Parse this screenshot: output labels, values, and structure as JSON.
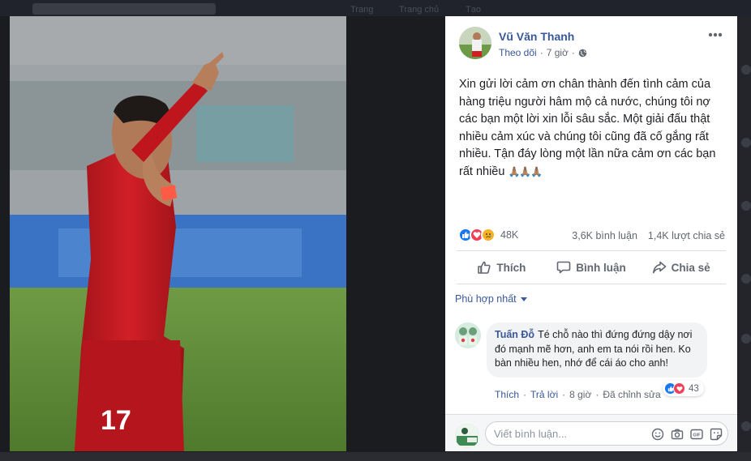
{
  "background": {
    "nav_items": [
      "Trang",
      "Trang chủ",
      "Tạo"
    ]
  },
  "post": {
    "author": "Vũ Văn Thanh",
    "follow": "Theo dõi",
    "separator": "·",
    "time": "7 giờ",
    "text": "Xin gửi lời cảm ơn chân thành đến tình cảm của hàng triệu người hâm mộ cả nước, chúng tôi nợ các bạn một lời xin lỗi sâu sắc. Một giải đấu thật nhiều cảm xúc và chúng tôi cũng đã cố gắng rất nhiều. Tận đáy lòng một lần nữa cảm ơn các bạn rất nhiều",
    "text_emoji": "🙏🏽🙏🏽🙏🏽",
    "reaction_count": "48K",
    "comments_count": "3,6K bình luận",
    "shares_count": "1,4K lượt chia sẻ",
    "shirt_number": "17"
  },
  "actions": {
    "like": "Thích",
    "comment": "Bình luận",
    "share": "Chia sẻ"
  },
  "sort": {
    "label": "Phù hợp nhất"
  },
  "comment": {
    "name": "Tuấn Đỗ",
    "text": "Té chỗ nào thì đứng đứng dậy nơi đó mạnh mẽ hơn, anh em ta nói rồi hen. Ko bàn nhiều hen, nhớ để cái áo cho anh!",
    "like": "Thích",
    "reply": "Trả lời",
    "time": "8 giờ",
    "edited": "Đã chỉnh sửa",
    "dot": "·",
    "reaction_count": "43"
  },
  "composer": {
    "placeholder": "Viết bình luận..."
  },
  "colors": {
    "link": "#385898",
    "like": "#1877f2",
    "love": "#f33e58",
    "sad": "#f7b125",
    "jersey": "#c8191e"
  },
  "icons": [
    "globe-icon",
    "more-icon",
    "like-icon",
    "comment-icon",
    "share-icon",
    "emoji-icon",
    "camera-icon",
    "gif-icon",
    "sticker-icon"
  ]
}
